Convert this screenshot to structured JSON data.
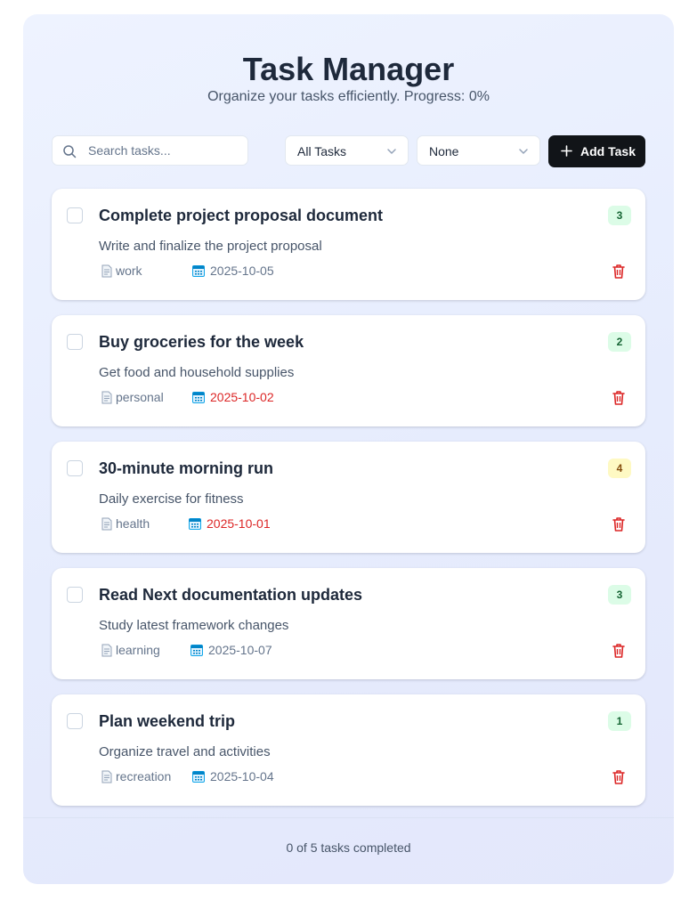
{
  "header": {
    "title": "Task Manager",
    "subtitle": "Organize your tasks efficiently. Progress: 0%"
  },
  "toolbar": {
    "search_placeholder": "Search tasks...",
    "filter_value": "All Tasks",
    "sort_value": "None",
    "add_label": "Add Task"
  },
  "colors": {
    "accent_dark": "#111418",
    "overdue": "#dc2626",
    "delete": "#dc2626"
  },
  "tasks": [
    {
      "title": "Complete project proposal document",
      "description": "Write and finalize the project proposal",
      "category": "work",
      "due": "2025-10-05",
      "priority": "3",
      "overdue": false
    },
    {
      "title": "Buy groceries for the week",
      "description": "Get food and household supplies",
      "category": "personal",
      "due": "2025-10-02",
      "priority": "2",
      "overdue": true
    },
    {
      "title": "30-minute morning run",
      "description": "Daily exercise for fitness",
      "category": "health",
      "due": "2025-10-01",
      "priority": "4",
      "overdue": true
    },
    {
      "title": "Read Next documentation updates",
      "description": "Study latest framework changes",
      "category": "learning",
      "due": "2025-10-07",
      "priority": "3",
      "overdue": false
    },
    {
      "title": "Plan weekend trip",
      "description": "Organize travel and activities",
      "category": "recreation",
      "due": "2025-10-04",
      "priority": "1",
      "overdue": false
    }
  ],
  "footer": {
    "summary": "0 of 5 tasks completed"
  }
}
